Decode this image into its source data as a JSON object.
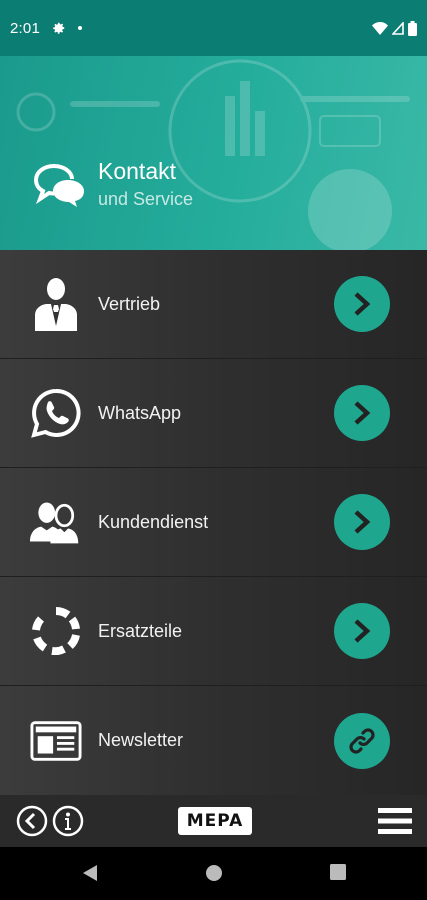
{
  "status_bar": {
    "time": "2:01",
    "icons": [
      "gear-icon",
      "notification-dot-icon",
      "wifi-icon",
      "signal-icon",
      "battery-icon"
    ]
  },
  "header": {
    "title": "Kontakt",
    "subtitle": "und Service",
    "icon": "chat-bubbles-icon",
    "accent_color": "#25ad9c"
  },
  "menu": {
    "items": [
      {
        "label": "Vertrieb",
        "icon": "businessman-icon",
        "action_icon": "chevron-right-icon"
      },
      {
        "label": "WhatsApp",
        "icon": "whatsapp-icon",
        "action_icon": "chevron-right-icon"
      },
      {
        "label": "Kundendienst",
        "icon": "users-icon",
        "action_icon": "chevron-right-icon"
      },
      {
        "label": "Ersatzteile",
        "icon": "spare-parts-icon",
        "action_icon": "chevron-right-icon"
      },
      {
        "label": "Newsletter",
        "icon": "newspaper-icon",
        "action_icon": "link-icon"
      }
    ],
    "button_color": "#1fa68f"
  },
  "bottom_bar": {
    "logo_text": "MEPA",
    "icons": [
      "back-icon",
      "info-icon",
      "hamburger-menu-icon"
    ]
  },
  "nav_bar": {
    "icons": [
      "nav-back-icon",
      "nav-home-icon",
      "nav-recents-icon"
    ]
  }
}
